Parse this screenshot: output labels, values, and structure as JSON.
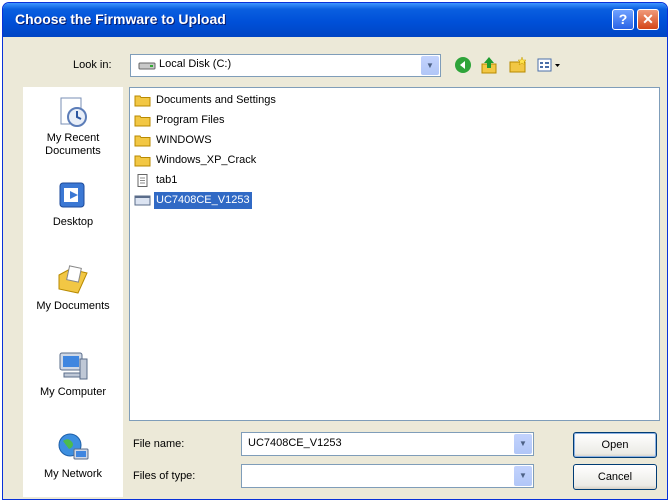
{
  "window": {
    "title": "Choose the Firmware to Upload",
    "help_glyph": "?",
    "close_glyph": "✕"
  },
  "toolbar": {
    "look_in_label": "Look in:",
    "look_in_value": "Local Disk (C:)",
    "icons": [
      "back-icon",
      "up-folder-icon",
      "new-folder-icon",
      "views-menu-icon"
    ]
  },
  "places": [
    {
      "label": "My Recent Documents",
      "icon": "recent-documents-icon"
    },
    {
      "label": "Desktop",
      "icon": "desktop-icon"
    },
    {
      "label": "My Documents",
      "icon": "my-documents-icon"
    },
    {
      "label": "My Computer",
      "icon": "my-computer-icon"
    },
    {
      "label": "My Network",
      "icon": "my-network-icon"
    }
  ],
  "files": [
    {
      "name": "Documents and Settings",
      "type": "folder"
    },
    {
      "name": "Program Files",
      "type": "folder"
    },
    {
      "name": "WINDOWS",
      "type": "folder"
    },
    {
      "name": "Windows_XP_Crack",
      "type": "folder"
    },
    {
      "name": "tab1",
      "type": "file"
    },
    {
      "name": "UC7408CE_V1253",
      "type": "file",
      "selected": true
    }
  ],
  "form": {
    "file_name_label": "File name:",
    "file_name_value": "UC7408CE_V1253",
    "file_type_label": "Files of type:",
    "file_type_value": "",
    "open_label": "Open",
    "cancel_label": "Cancel"
  },
  "colors": {
    "title_bar": "#0050D8",
    "selection": "#316AC5",
    "dialog_bg": "#ECE9D8"
  }
}
